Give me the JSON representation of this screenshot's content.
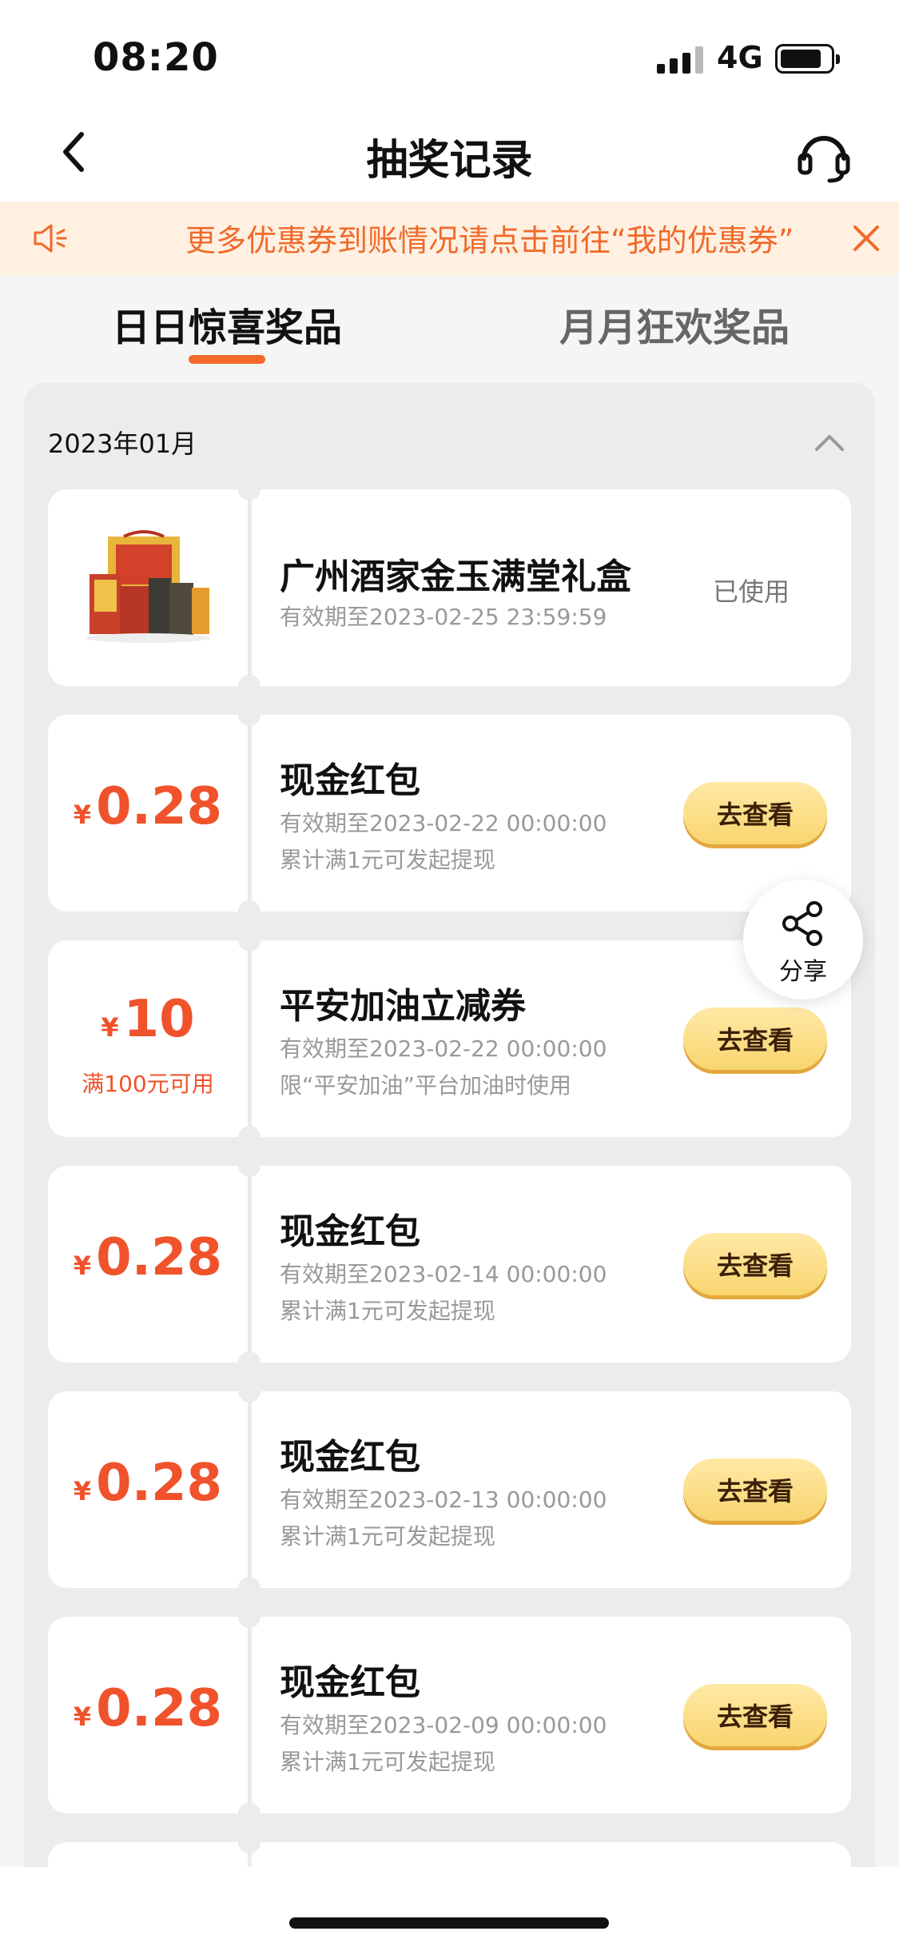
{
  "status_bar": {
    "time": "08:20",
    "network": "4G"
  },
  "nav": {
    "title": "抽奖记录"
  },
  "notice": {
    "text": "更多优惠券到账情况请点击前往“我的优惠券”"
  },
  "tabs": [
    {
      "label": "日日惊喜奖品",
      "active": true
    },
    {
      "label": "月月狂欢奖品",
      "active": false
    }
  ],
  "month": {
    "label": "2023年01月"
  },
  "prizes": [
    {
      "type": "gift",
      "image": "gift-box-image",
      "name": "广州酒家金玉满堂礼盒",
      "valid": "有效期至2023-02-25 23:59:59",
      "status": "已使用"
    },
    {
      "type": "cash",
      "currency": "¥",
      "amount": "0.28",
      "name": "现金红包",
      "valid": "有效期至2023-02-22 00:00:00",
      "note": "累计满1元可发起提现",
      "button": "去查看"
    },
    {
      "type": "coupon",
      "currency": "¥",
      "amount": "10",
      "condition": "满100元可用",
      "name": "平安加油立减券",
      "valid": "有效期至2023-02-22 00:00:00",
      "note": "限“平安加油”平台加油时使用",
      "button": "去查看"
    },
    {
      "type": "cash",
      "currency": "¥",
      "amount": "0.28",
      "name": "现金红包",
      "valid": "有效期至2023-02-14 00:00:00",
      "note": "累计满1元可发起提现",
      "button": "去查看"
    },
    {
      "type": "cash",
      "currency": "¥",
      "amount": "0.28",
      "name": "现金红包",
      "valid": "有效期至2023-02-13 00:00:00",
      "note": "累计满1元可发起提现",
      "button": "去查看"
    },
    {
      "type": "cash",
      "currency": "¥",
      "amount": "0.28",
      "name": "现金红包",
      "valid": "有效期至2023-02-09 00:00:00",
      "note": "累计满1元可发起提现",
      "button": "去查看"
    }
  ],
  "share": {
    "label": "分享"
  },
  "colors": {
    "accent": "#f0522b",
    "notice_bg": "#fff0e2",
    "button": "#f8d56f"
  }
}
